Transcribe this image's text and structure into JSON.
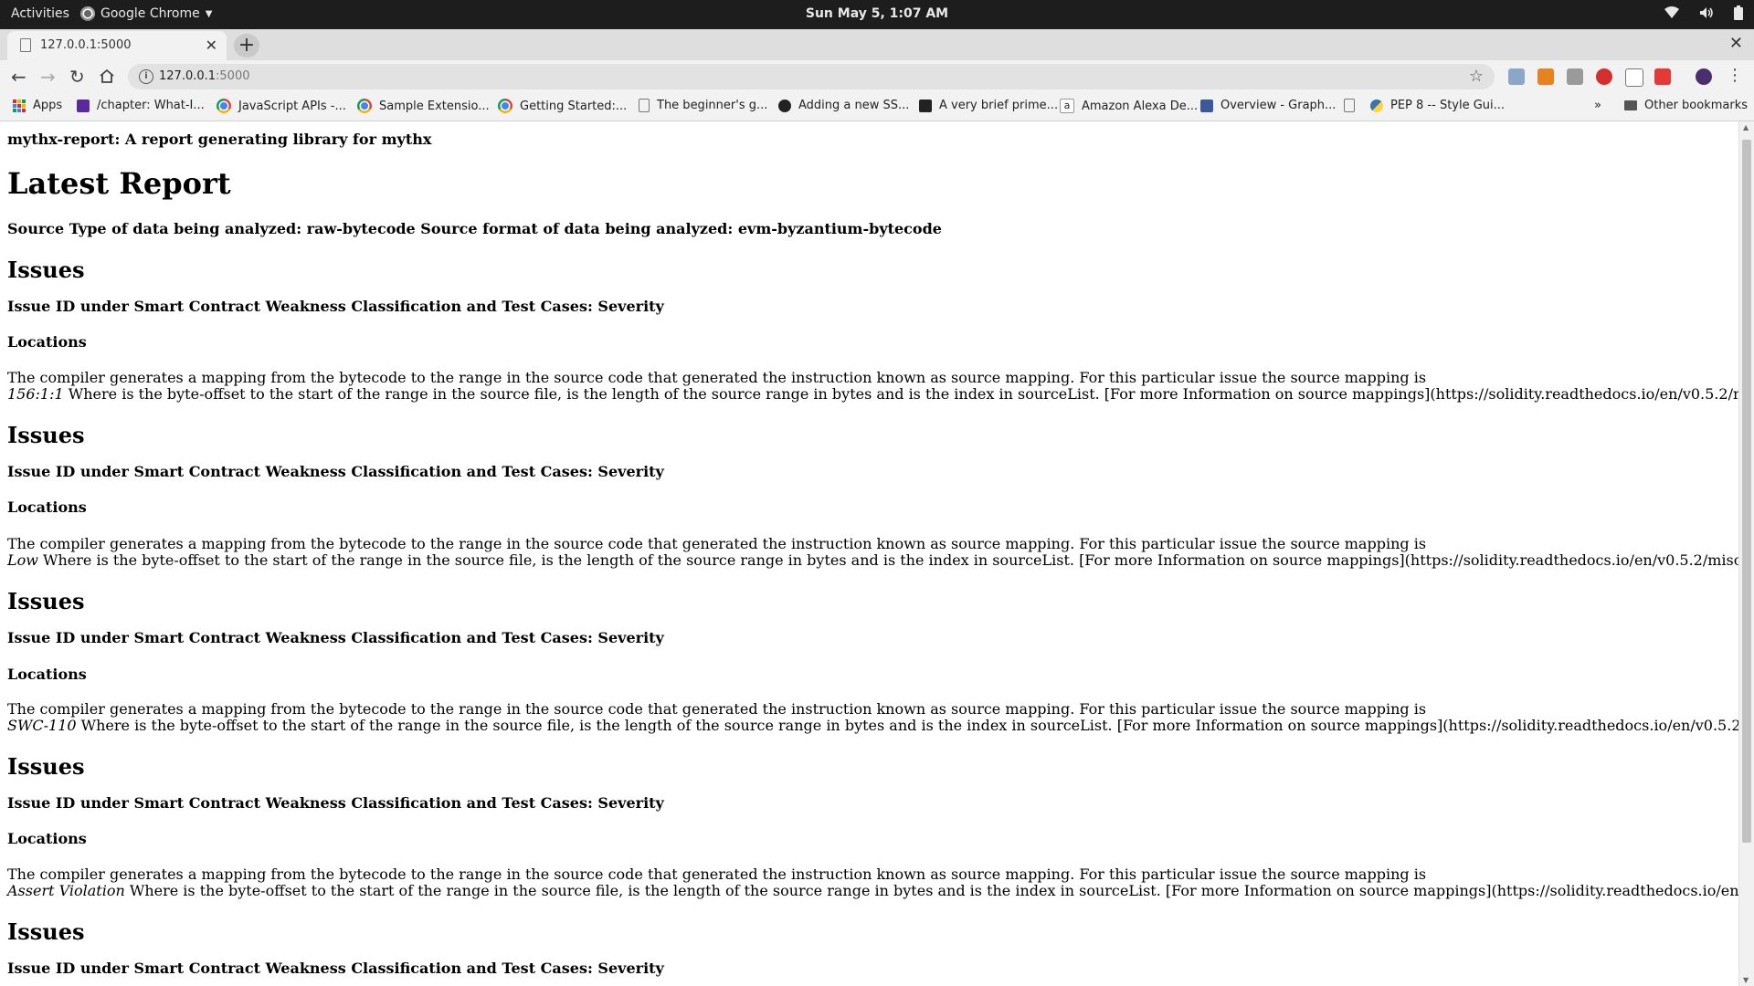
{
  "topbar": {
    "activities": "Activities",
    "app_name": "Google Chrome",
    "clock": "Sun May  5,  1:07 AM"
  },
  "browser": {
    "tab_title": "127.0.0.1:5000",
    "url_host": "127.0.0.1",
    "url_port": ":5000",
    "bookmarks": [
      {
        "label": "Apps",
        "icon": "apps-grid-icon"
      },
      {
        "label": "/chapter: What-I...",
        "icon": "bird-icon"
      },
      {
        "label": "JavaScript APIs -...",
        "icon": "chrome-icon"
      },
      {
        "label": "Sample Extensio...",
        "icon": "chrome-icon"
      },
      {
        "label": "Getting Started:...",
        "icon": "chrome-icon"
      },
      {
        "label": "The beginner's g...",
        "icon": "page-icon"
      },
      {
        "label": "Adding a new SS...",
        "icon": "github-icon"
      },
      {
        "label": "A very brief prime...",
        "icon": "chart-icon"
      },
      {
        "label": "Amazon Alexa De...",
        "icon": "amazon-icon"
      },
      {
        "label": "Overview - Graph...",
        "icon": "facebook-icon"
      },
      {
        "label": "",
        "icon": "page-icon"
      },
      {
        "label": "PEP 8 -- Style Gui...",
        "icon": "python-icon"
      }
    ],
    "overflow": "»",
    "other_bookmarks": "Other bookmarks"
  },
  "page": {
    "header": "mythx-report: A report generating library for mythx",
    "title": "Latest Report",
    "source_line": "Source Type of data being analyzed: raw-bytecode Source format of data being analyzed: evm-byzantium-bytecode",
    "issues": [
      {
        "heading": "Issues",
        "issue_id": "Issue ID under Smart Contract Weakness Classification and Test Cases: Severity",
        "locations": "Locations",
        "text1": "The compiler generates a mapping from the bytecode to the range in the source code that generated the instruction known as source mapping. For this particular issue the source mapping is",
        "mapping": "156:1:1",
        "text2": " Where is the byte-offset to the start of the range in the source file, is the length of the source range in bytes and is the index in sourceList. [For more Information on source mappings](https://solidity.readthedocs.io/en/v0.5.2/miscellaneous.html#source-mappings)"
      },
      {
        "heading": "Issues",
        "issue_id": "Issue ID under Smart Contract Weakness Classification and Test Cases: Severity",
        "locations": "Locations",
        "text1": "The compiler generates a mapping from the bytecode to the range in the source code that generated the instruction known as source mapping. For this particular issue the source mapping is",
        "mapping": "Low",
        "text2": " Where is the byte-offset to the start of the range in the source file, is the length of the source range in bytes and is the index in sourceList. [For more Information on source mappings](https://solidity.readthedocs.io/en/v0.5.2/miscellaneous.html#source-mappings)"
      },
      {
        "heading": "Issues",
        "issue_id": "Issue ID under Smart Contract Weakness Classification and Test Cases: Severity",
        "locations": "Locations",
        "text1": "The compiler generates a mapping from the bytecode to the range in the source code that generated the instruction known as source mapping. For this particular issue the source mapping is",
        "mapping": "SWC-110",
        "text2": " Where is the byte-offset to the start of the range in the source file, is the length of the source range in bytes and is the index in sourceList. [For more Information on source mappings](https://solidity.readthedocs.io/en/v0.5.2/miscellaneous.html#source-mappings)"
      },
      {
        "heading": "Issues",
        "issue_id": "Issue ID under Smart Contract Weakness Classification and Test Cases: Severity",
        "locations": "Locations",
        "text1": "The compiler generates a mapping from the bytecode to the range in the source code that generated the instruction known as source mapping. For this particular issue the source mapping is",
        "mapping": "Assert Violation",
        "text2": " Where is the byte-offset to the start of the range in the source file, is the length of the source range in bytes and is the index in sourceList. [For more Information on source mappings](https://solidity.readthedocs.io/en/v0.5.2/miscellaneous.html#source-mappings)"
      },
      {
        "heading": "Issues",
        "issue_id": "Issue ID under Smart Contract Weakness Classification and Test Cases: Severity"
      }
    ]
  }
}
